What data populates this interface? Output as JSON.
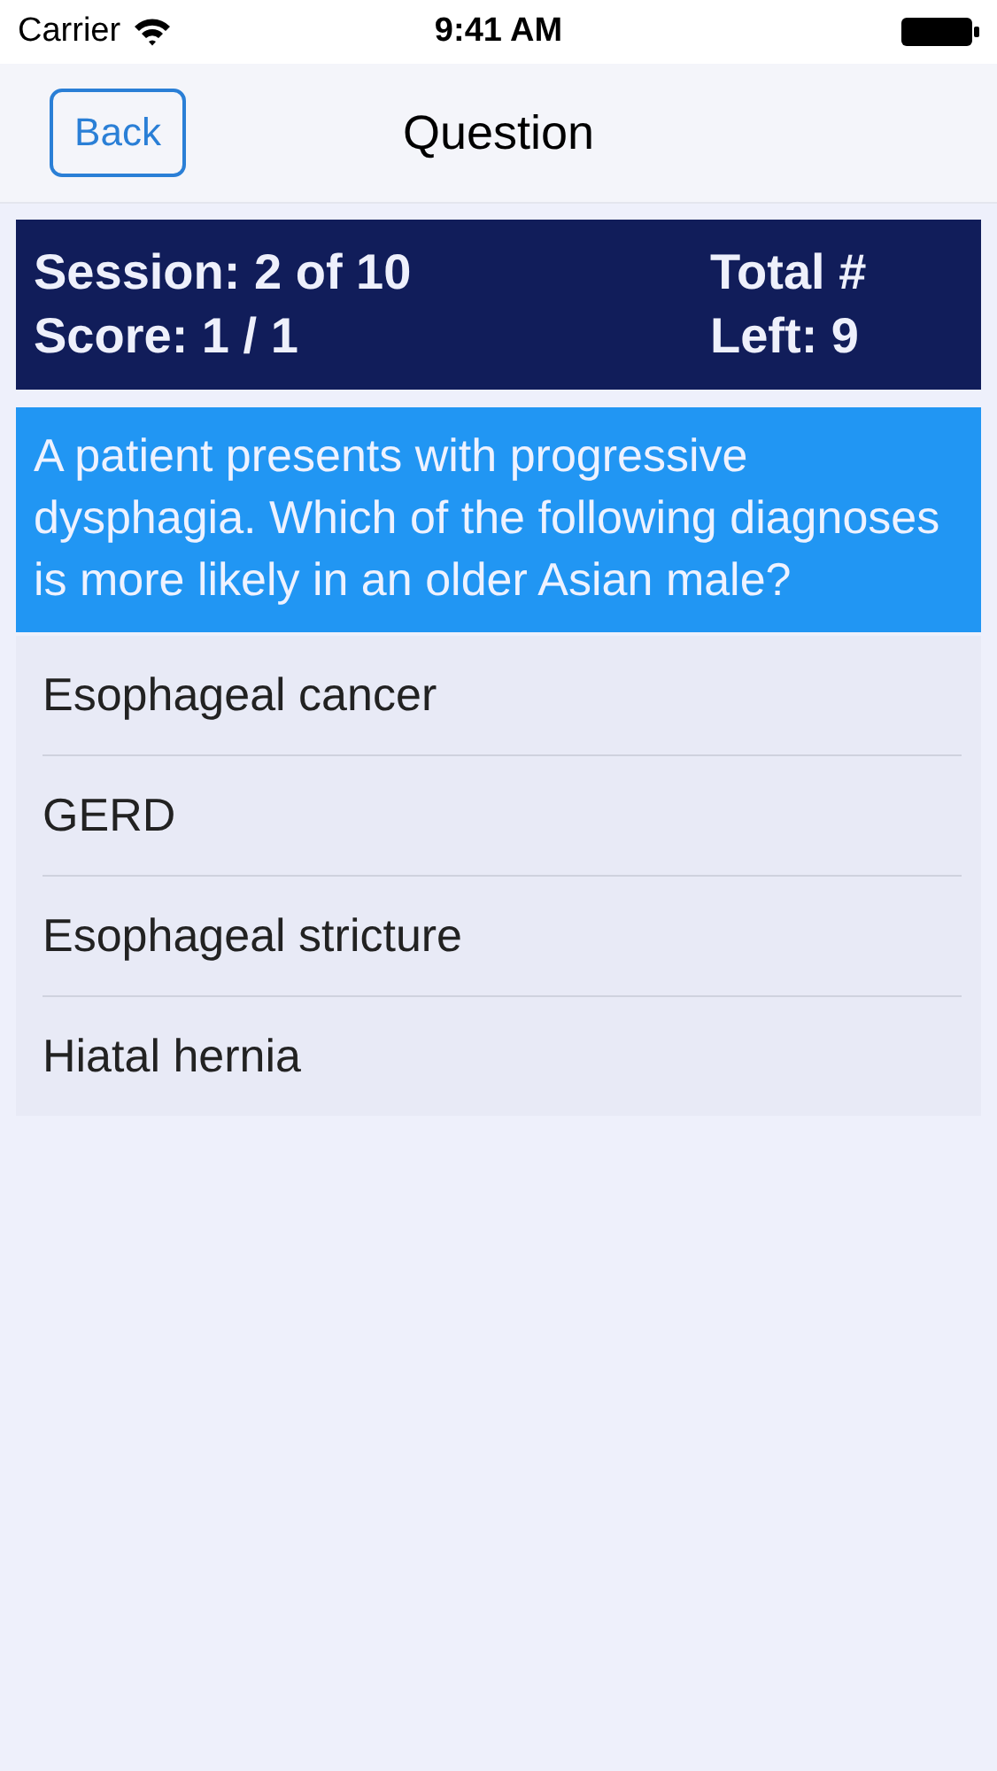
{
  "status_bar": {
    "carrier": "Carrier",
    "time": "9:41 AM"
  },
  "nav": {
    "back": "Back",
    "title": "Question"
  },
  "stats": {
    "session": "Session: 2 of 10",
    "score": "Score: 1 / 1",
    "total": "Total #",
    "left": "Left: 9"
  },
  "question": "A patient presents with progressive dysphagia. Which of the following diagnoses is more likely in an older Asian male?",
  "answers": [
    "Esophageal cancer",
    "GERD",
    "Esophageal stricture",
    "Hiatal hernia"
  ]
}
